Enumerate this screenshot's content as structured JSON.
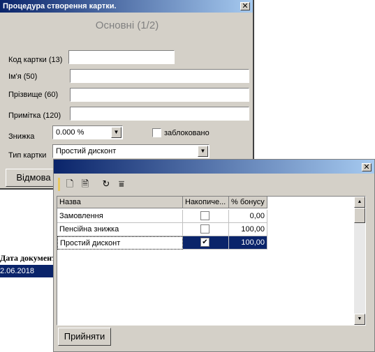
{
  "background": {
    "column_header": "Дата документ",
    "selected_row": "2.06.2018"
  },
  "main_window": {
    "title": "Процедура створення картки.",
    "section_title": "Основні (1/2)",
    "fields": {
      "card_code_label": "Код картки (13)",
      "card_code_value": "",
      "name_label": "Ім'я  (50)",
      "name_value": "",
      "surname_label": "Прізвище (60)",
      "surname_value": "",
      "note_label": "Примітка (120)",
      "note_value": "",
      "discount_label": "Знижка",
      "discount_value": "0.000 %",
      "blocked_label": "заблоковано",
      "blocked_checked": false,
      "card_type_label": "Тип картки",
      "card_type_value": "Простий дисконт"
    },
    "cancel_label": "Відмова"
  },
  "popup": {
    "columns": [
      "Назва",
      "Накопиче...",
      "% бонусу"
    ],
    "rows": [
      {
        "name": "Замовлення",
        "accumulative": false,
        "bonus": "0,00",
        "selected": false
      },
      {
        "name": "Пенсійна знижка",
        "accumulative": false,
        "bonus": "100,00",
        "selected": false
      },
      {
        "name": "Простий дисконт",
        "accumulative": true,
        "bonus": "100,00",
        "selected": true
      }
    ],
    "accept_label": "Прийняти",
    "toolbar_icons": [
      "new-document-icon",
      "edit-document-icon",
      "refresh-icon",
      "filter-icon"
    ]
  }
}
